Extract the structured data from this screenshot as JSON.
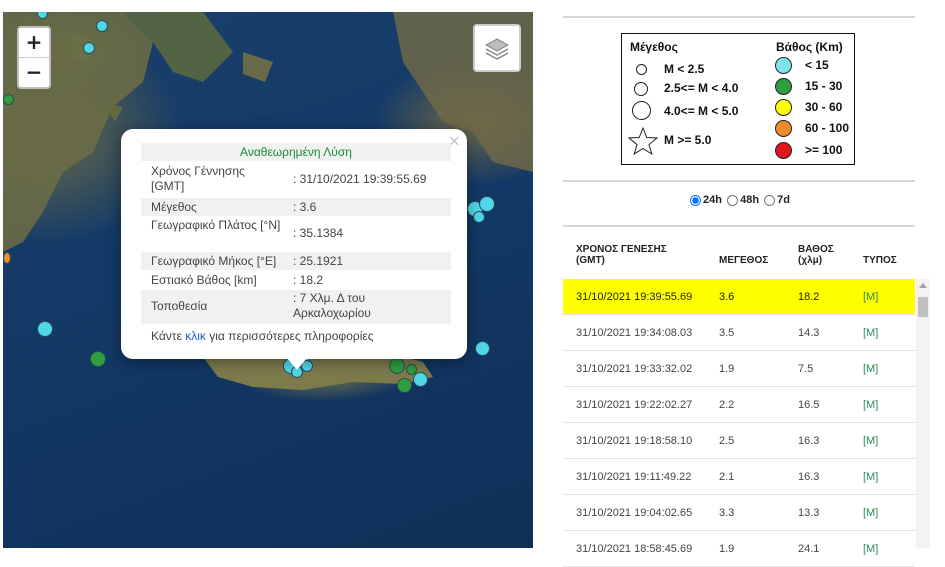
{
  "map": {
    "zoom_in": "+",
    "zoom_out": "−",
    "icons": {
      "layers": "layers-icon"
    },
    "earthquakes": [
      {
        "color": "#4fd7e8",
        "size": "small"
      },
      {
        "color": "#2e9e3f",
        "size": "small"
      }
    ]
  },
  "popup": {
    "close": "×",
    "title": "Αναθεωρημένη Λύση",
    "rows": [
      {
        "label": "Χρόνος Γέννησης [GMT]",
        "value": ": 31/10/2021 19:39:55.69"
      },
      {
        "label": "Μέγεθος",
        "value": ": 3.6"
      },
      {
        "label": "Γεωγραφικό Πλάτος [°N]",
        "value": ": 35.1384"
      },
      {
        "label": "Γεωγραφικό Μήκος [°E]",
        "value": ": 25.1921"
      },
      {
        "label": "Εστιακό Βάθος [km]",
        "value": ": 18.2"
      },
      {
        "label": "Τοποθεσία",
        "value": ": 7 Χλμ. Δ του Αρκαλοχωρίου"
      }
    ],
    "more_prefix": "Κάντε ",
    "more_link": "κλικ",
    "more_suffix": " για περισσότερες πληροφορίες"
  },
  "legend": {
    "magnitude_title": "Μέγεθος",
    "depth_title": "Βάθος (Km)",
    "magnitudes": [
      "M < 2.5",
      "2.5<= M < 4.0",
      "4.0<= M < 5.0",
      "M >= 5.0"
    ],
    "depths": [
      {
        "label": "< 15",
        "color": "#7fe3ee"
      },
      {
        "label": "15 - 30",
        "color": "#2e9e3f"
      },
      {
        "label": "30 - 60",
        "color": "#ffff00"
      },
      {
        "label": "60 - 100",
        "color": "#f08a2a"
      },
      {
        "label": ">= 100",
        "color": "#e0161c"
      }
    ]
  },
  "filters": {
    "options": [
      "24h",
      "48h",
      "7d"
    ],
    "selected": "24h"
  },
  "table": {
    "headers": {
      "time": "ΧΡΟΝΟΣ ΓΕΝΕΣΗΣ (GMT)",
      "mag": "ΜΕΓΕΘΟΣ",
      "depth": "ΒΑΘΟΣ (χλμ)",
      "type": "ΤΥΠΟΣ"
    },
    "rows": [
      {
        "time": "31/10/2021 19:39:55.69",
        "mag": "3.6",
        "depth": "18.2",
        "type": "[M]"
      },
      {
        "time": "31/10/2021 19:34:08.03",
        "mag": "3.5",
        "depth": "14.3",
        "type": "[M]"
      },
      {
        "time": "31/10/2021 19:33:32.02",
        "mag": "1.9",
        "depth": "7.5",
        "type": "[M]"
      },
      {
        "time": "31/10/2021 19:22:02.27",
        "mag": "2.2",
        "depth": "16.5",
        "type": "[M]"
      },
      {
        "time": "31/10/2021 19:18:58.10",
        "mag": "2.5",
        "depth": "16.3",
        "type": "[M]"
      },
      {
        "time": "31/10/2021 19:11:49.22",
        "mag": "2.1",
        "depth": "16.3",
        "type": "[M]"
      },
      {
        "time": "31/10/2021 19:04:02.65",
        "mag": "3.3",
        "depth": "13.3",
        "type": "[M]"
      },
      {
        "time": "31/10/2021 18:58:45.69",
        "mag": "1.9",
        "depth": "24.1",
        "type": "[M]"
      }
    ]
  }
}
